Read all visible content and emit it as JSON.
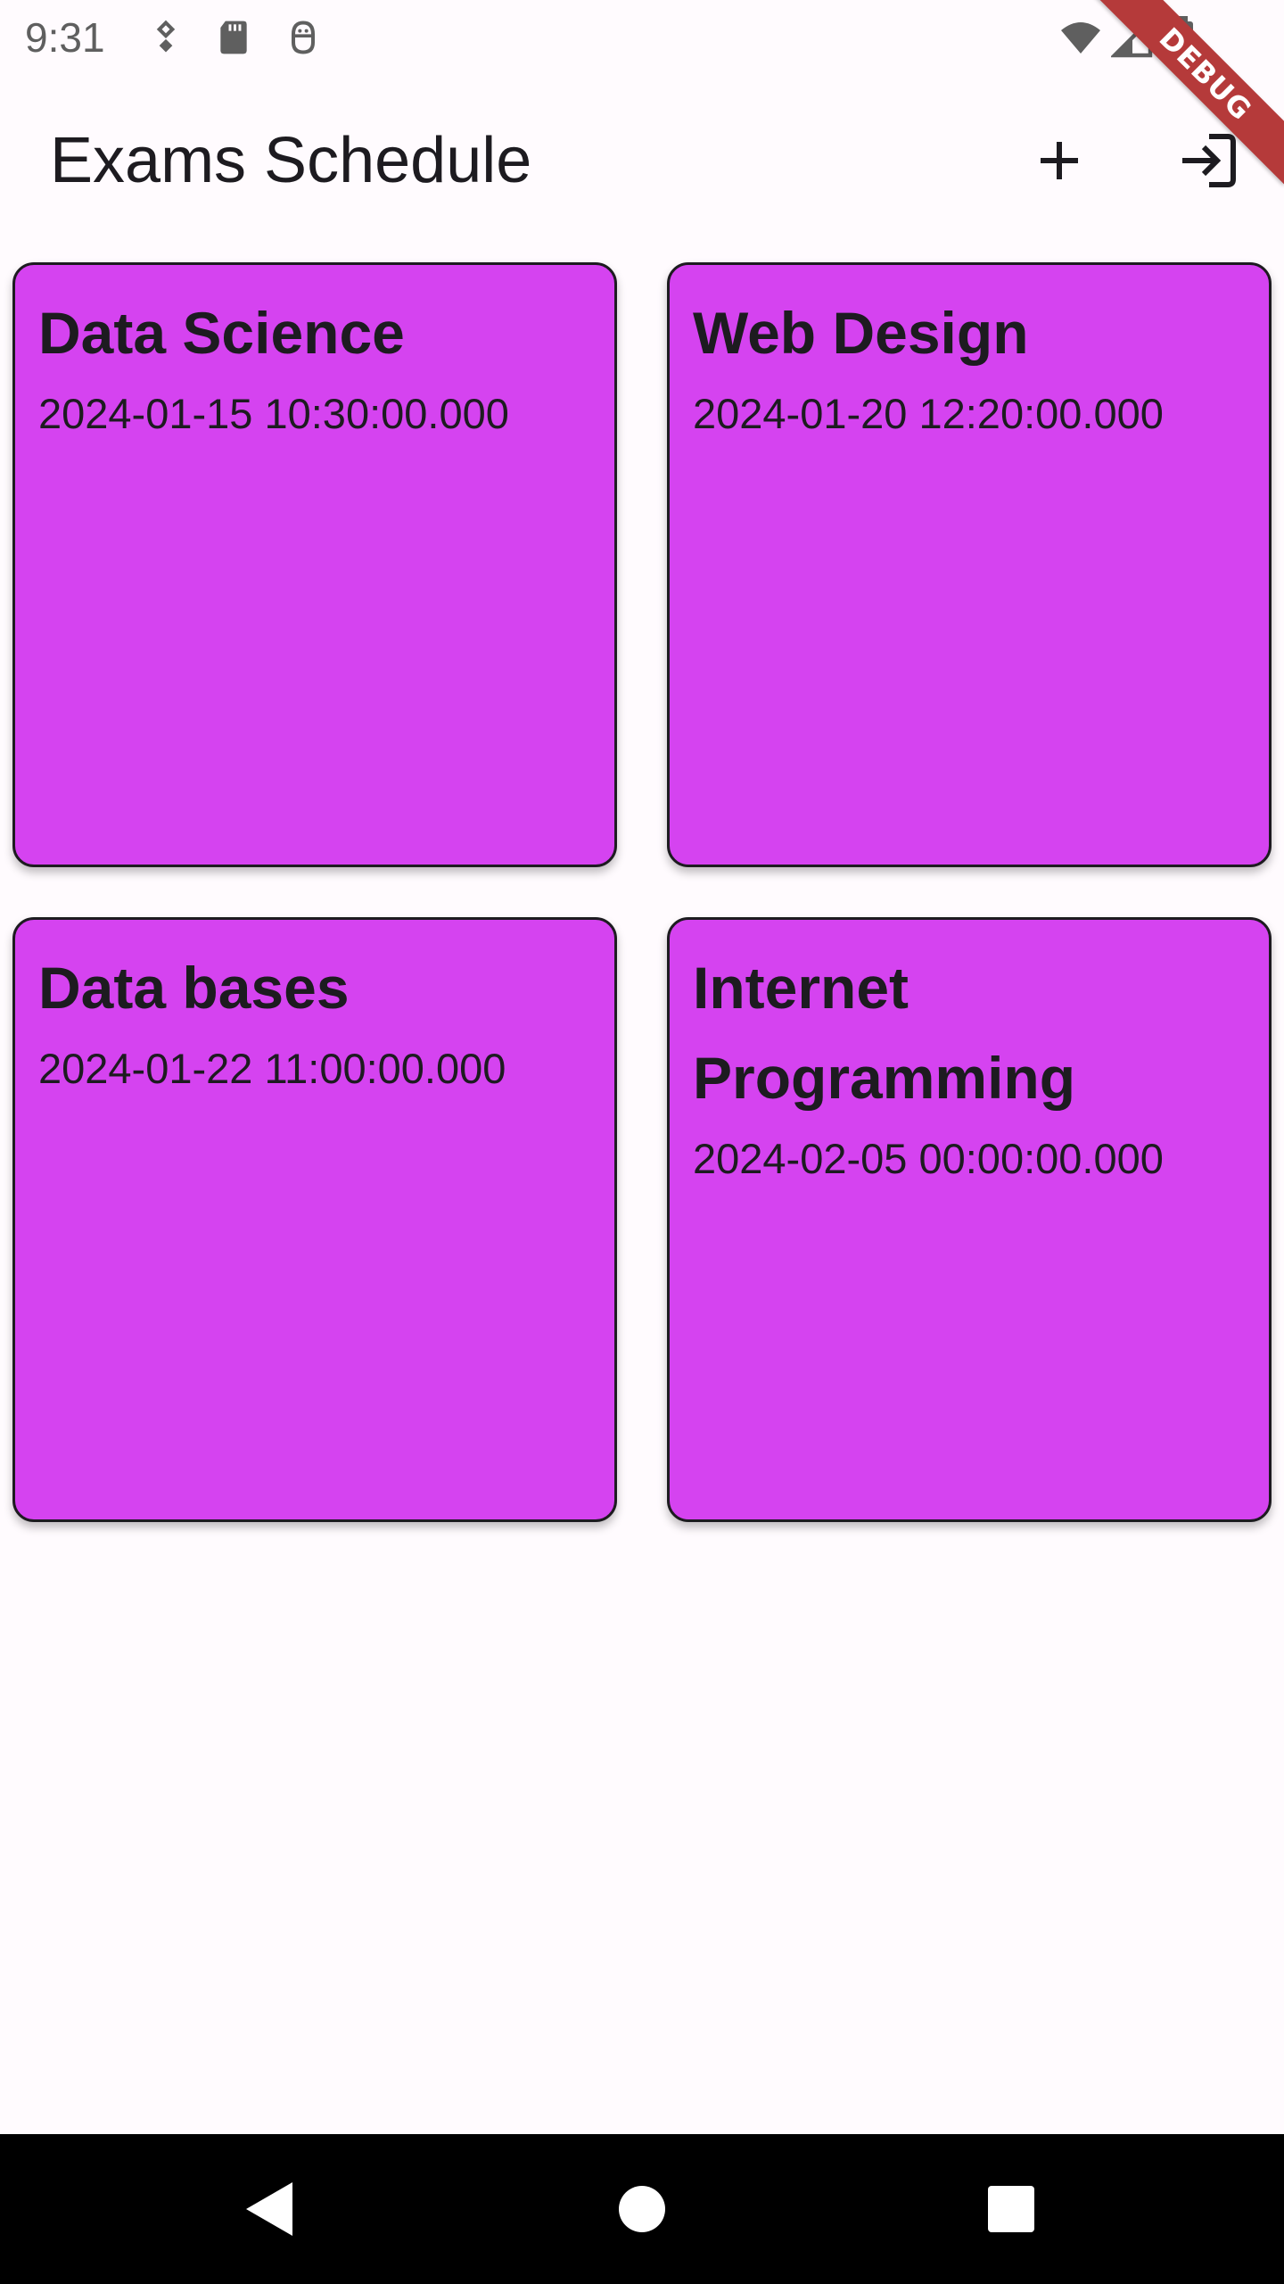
{
  "status_bar": {
    "time": "9:31",
    "icons": [
      "location-pin-icon",
      "sd-card-icon",
      "android-debug-icon",
      "wifi-icon",
      "cellular-signal-icon",
      "battery-icon"
    ]
  },
  "debug_banner": {
    "label": "DEBUG"
  },
  "app_bar": {
    "title": "Exams Schedule",
    "actions": [
      {
        "name": "add-exam-button",
        "icon": "plus-icon"
      },
      {
        "name": "login-button",
        "icon": "login-icon"
      }
    ]
  },
  "exams": [
    {
      "title": "Data Science",
      "datetime": "2024-01-15 10:30:00.000"
    },
    {
      "title": "Web Design",
      "datetime": "2024-01-20 12:20:00.000"
    },
    {
      "title": "Data bases",
      "datetime": "2024-01-22 11:00:00.000"
    },
    {
      "title": "Internet Programming",
      "datetime": "2024-02-05 00:00:00.000"
    }
  ],
  "colors": {
    "background": "#fffbfe",
    "card": "#d543f0",
    "text": "#1d1b20",
    "debug_banner": "#b53a3a",
    "nav_bar": "#000000"
  },
  "nav_bar": {
    "buttons": [
      "back-icon",
      "home-icon",
      "recents-icon"
    ]
  }
}
